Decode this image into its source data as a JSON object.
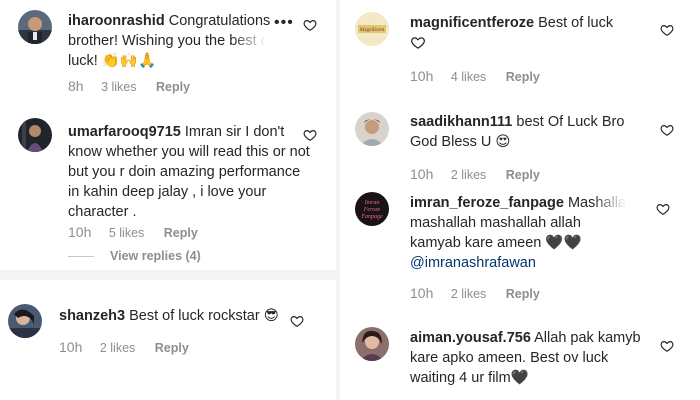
{
  "colors": {
    "text": "#262626",
    "meta": "#8e8e8e",
    "mention": "#00376b",
    "panel_gap": "#f4f4f4"
  },
  "left": {
    "comments": [
      {
        "username": "iharoonrashid",
        "text": "Congratulations brother! Wishing you the best of luck! 👏🙌🙏",
        "time": "8h",
        "likes": "3 likes",
        "reply": "Reply",
        "icon": "heart-outline-icon"
      },
      {
        "username": "umarfarooq9715",
        "text": "Imran sir I don't know whether you will read this or not but you r doin amazing performance in kahin deep jalay , i love your character .",
        "time": "10h",
        "likes": "5 likes",
        "reply": "Reply",
        "view_replies": "View replies (4)",
        "icon": "heart-outline-icon"
      },
      {
        "username": "shanzeh3",
        "text": "Best of luck rockstar 😎",
        "time": "10h",
        "likes": "2 likes",
        "reply": "Reply",
        "icon": "heart-outline-icon"
      }
    ]
  },
  "right": {
    "comments": [
      {
        "username": "magnificentferoze",
        "text": "Best of luck",
        "time": "10h",
        "likes": "4 likes",
        "reply": "Reply",
        "icon": "heart-outline-icon"
      },
      {
        "username": "saadikhann111",
        "text": "best Of Luck Bro God Bless U 😍",
        "time": "10h",
        "likes": "2 likes",
        "reply": "Reply",
        "icon": "heart-outline-icon"
      },
      {
        "username": "imran_feroze_fanpage",
        "text": "Mashallah mashallah mashallah allah kamyab kare ameen 🖤🖤",
        "mention": "@imranashrafawan",
        "time": "10h",
        "likes": "2 likes",
        "reply": "Reply",
        "icon": "heart-outline-icon"
      },
      {
        "username": "aiman.yousaf.756",
        "text": "Allah pak kamyb kare apko ameen. Best ov luck waiting 4 ur film🖤",
        "icon": "heart-outline-icon"
      }
    ]
  },
  "more_options": "•••",
  "avatar_logo_text": {
    "magnificentferoze": "Magnificent",
    "fanpage": [
      "Imran",
      "Feroze",
      "Fanpage"
    ]
  }
}
